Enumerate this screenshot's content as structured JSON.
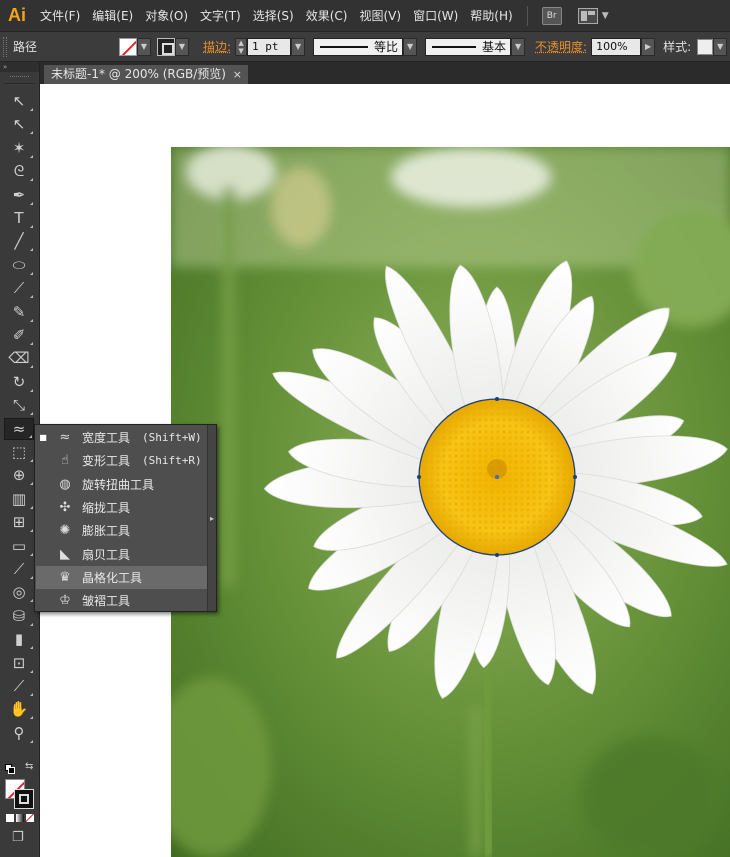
{
  "app": {
    "logo": "Ai"
  },
  "menu": {
    "items": [
      "文件(F)",
      "编辑(E)",
      "对象(O)",
      "文字(T)",
      "选择(S)",
      "效果(C)",
      "视图(V)",
      "窗口(W)",
      "帮助(H)"
    ],
    "bridge_label": "Br"
  },
  "control": {
    "object_type": "路径",
    "stroke_label": "描边:",
    "stroke_weight": "1 pt",
    "profile_label": "等比",
    "brush_label": "基本",
    "opacity_label": "不透明度:",
    "opacity_value": "100%",
    "style_label": "样式:"
  },
  "document": {
    "tab_title": "未标题-1* @ 200% (RGB/预览)",
    "close_glyph": "×"
  },
  "toolbar": {
    "collapse_glyph": "»",
    "tools": [
      {
        "name": "selection-tool",
        "glyph": "↖",
        "active": false
      },
      {
        "name": "direct-selection-tool",
        "glyph": "↖",
        "active": false
      },
      {
        "name": "magic-wand-tool",
        "glyph": "✶",
        "active": false
      },
      {
        "name": "lasso-tool",
        "glyph": "ᘓ",
        "active": false
      },
      {
        "name": "pen-tool",
        "glyph": "✒",
        "active": false
      },
      {
        "name": "type-tool",
        "glyph": "T",
        "active": false
      },
      {
        "name": "line-segment-tool",
        "glyph": "╱",
        "active": false
      },
      {
        "name": "ellipse-tool",
        "glyph": "⬭",
        "active": false
      },
      {
        "name": "paintbrush-tool",
        "glyph": "⟋",
        "active": false
      },
      {
        "name": "pencil-tool",
        "glyph": "✎",
        "active": false
      },
      {
        "name": "blob-brush-tool",
        "glyph": "✐",
        "active": false
      },
      {
        "name": "eraser-tool",
        "glyph": "⌫",
        "active": false
      },
      {
        "name": "rotate-tool",
        "glyph": "↻",
        "active": false
      },
      {
        "name": "scale-tool",
        "glyph": "⤡",
        "active": false
      },
      {
        "name": "width-tool",
        "glyph": "≈",
        "active": true
      },
      {
        "name": "free-transform-tool",
        "glyph": "⬚",
        "active": false
      },
      {
        "name": "shape-builder-tool",
        "glyph": "⊕",
        "active": false
      },
      {
        "name": "perspective-grid-tool",
        "glyph": "▥",
        "active": false
      },
      {
        "name": "mesh-tool",
        "glyph": "⊞",
        "active": false
      },
      {
        "name": "gradient-tool",
        "glyph": "▭",
        "active": false
      },
      {
        "name": "eyedropper-tool",
        "glyph": "⟋",
        "active": false
      },
      {
        "name": "blend-tool",
        "glyph": "◎",
        "active": false
      },
      {
        "name": "symbol-sprayer-tool",
        "glyph": "⛁",
        "active": false
      },
      {
        "name": "column-graph-tool",
        "glyph": "▮",
        "active": false
      },
      {
        "name": "artboard-tool",
        "glyph": "⊡",
        "active": false
      },
      {
        "name": "slice-tool",
        "glyph": "⟋",
        "active": false
      },
      {
        "name": "hand-tool",
        "glyph": "✋",
        "active": false
      },
      {
        "name": "zoom-tool",
        "glyph": "⚲",
        "active": false
      }
    ]
  },
  "flyout": {
    "items": [
      {
        "label": "宽度工具",
        "shortcut": "(Shift+W)",
        "selected": true,
        "highlighted": false,
        "icon": "width-tool-icon",
        "glyph": "≈"
      },
      {
        "label": "变形工具",
        "shortcut": "(Shift+R)",
        "selected": false,
        "highlighted": false,
        "icon": "warp-tool-icon",
        "glyph": "☝"
      },
      {
        "label": "旋转扭曲工具",
        "shortcut": "",
        "selected": false,
        "highlighted": false,
        "icon": "twirl-tool-icon",
        "glyph": "◍"
      },
      {
        "label": "缩拢工具",
        "shortcut": "",
        "selected": false,
        "highlighted": false,
        "icon": "pucker-tool-icon",
        "glyph": "✣"
      },
      {
        "label": "膨胀工具",
        "shortcut": "",
        "selected": false,
        "highlighted": false,
        "icon": "bloat-tool-icon",
        "glyph": "✺"
      },
      {
        "label": "扇贝工具",
        "shortcut": "",
        "selected": false,
        "highlighted": false,
        "icon": "scallop-tool-icon",
        "glyph": "◣"
      },
      {
        "label": "晶格化工具",
        "shortcut": "",
        "selected": false,
        "highlighted": true,
        "icon": "crystallize-tool-icon",
        "glyph": "♛"
      },
      {
        "label": "皱褶工具",
        "shortcut": "",
        "selected": false,
        "highlighted": false,
        "icon": "wrinkle-tool-icon",
        "glyph": "♔"
      }
    ],
    "expand_glyph": "▸"
  },
  "colors": {
    "accent": "#f7a21b",
    "stroke_label": "#e98f2f",
    "selection_path": "#1e3f7a"
  }
}
